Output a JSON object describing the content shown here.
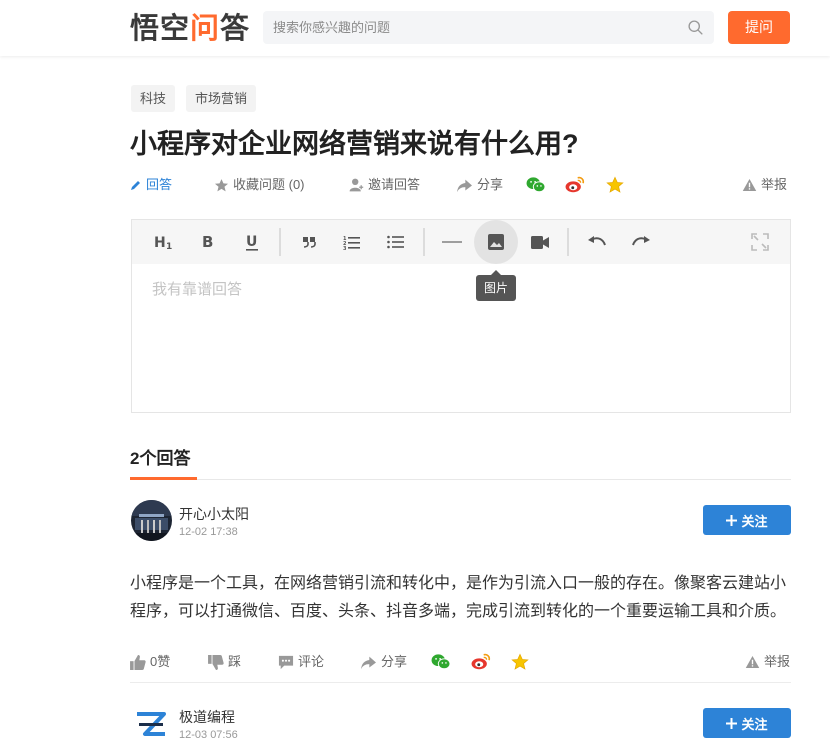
{
  "brand": {
    "logo_main": "悟空",
    "logo_accent": "问",
    "logo_end": "答",
    "accent_color": "#ff6a2e",
    "link_color": "#2d83d7"
  },
  "search": {
    "placeholder": "搜索你感兴趣的问题",
    "icon": "search-icon"
  },
  "header": {
    "ask_label": "提问"
  },
  "tags": [
    "科技",
    "市场营销"
  ],
  "question": {
    "title": "小程序对企业网络营销来说有什么用?",
    "actions": {
      "answer": "回答",
      "favorite": "收藏问题 (0)",
      "invite": "邀请回答",
      "share": "分享",
      "report": "举报"
    }
  },
  "editor": {
    "placeholder": "我有靠谱回答",
    "tooltip": "图片",
    "toolbar": [
      "heading-icon",
      "bold-icon",
      "underline-icon",
      "quote-icon",
      "ordered-list-icon",
      "bullet-list-icon",
      "divider-icon",
      "image-icon",
      "video-icon",
      "undo-icon",
      "redo-icon",
      "fullscreen-icon"
    ]
  },
  "answers_header": "2个回答",
  "answers": [
    {
      "user": "开心小太阳",
      "date": "12-02 17:38",
      "follow_label": "关注",
      "text": "小程序是一个工具，在网络营销引流和转化中，是作为引流入口一般的存在。像聚客云建站小程序，可以打通微信、百度、头条、抖音多端，完成引流到转化的一个重要运输工具和介质。",
      "like": "0赞",
      "dislike": "踩",
      "comment": "评论",
      "share": "分享",
      "report": "举报"
    },
    {
      "user": "极道编程",
      "date": "12-03 07:56",
      "follow_label": "关注"
    }
  ]
}
